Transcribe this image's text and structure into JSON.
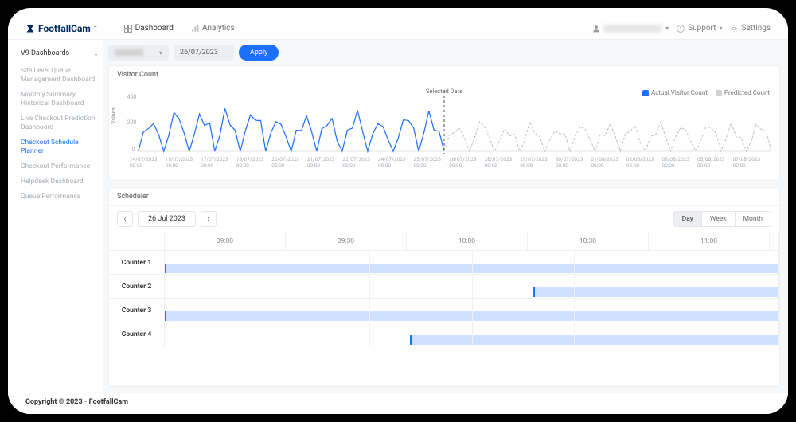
{
  "brand": {
    "name": "FootfallCam",
    "tm": "™"
  },
  "topnav": {
    "dashboard": "Dashboard",
    "analytics": "Analytics"
  },
  "topright": {
    "support": "Support",
    "settings": "Settings"
  },
  "sidebar": {
    "heading": "V9 Dashboards",
    "items": [
      "Site Level Queue Management Dashboard",
      "Monthly Summary Historical Dashboard",
      "Live Checkout Prediction Dashboard",
      "Checkout Schedule Planner",
      "Checkout Performance",
      "Helpdesk Dashboard",
      "Queue Performance"
    ],
    "active_index": 3
  },
  "filters": {
    "date": "26/07/2023",
    "apply": "Apply"
  },
  "chart": {
    "title": "Visitor Count",
    "selected_date_label": "Selected Date",
    "ylabel": "Values",
    "legend": {
      "actual": "Actual Visitor Count",
      "predicted": "Predicted Count"
    },
    "xticks": [
      "14/07/2023 00:00",
      "15/07/2023 00:00",
      "17/07/2023 00:00",
      "18/07/2023 00:00",
      "20/07/2023 00:00",
      "21/07/2023 00:00",
      "22/07/2023 00:00",
      "24/07/2023 00:00",
      "25/07/2023 00:00",
      "26/07/2023 00:00",
      "28/07/2023 00:00",
      "29/07/2023 00:00",
      "30/07/2023 00:00",
      "01/08/2023 00:00",
      "02/08/2023 00:00",
      "03/08/2023 00:00",
      "05/08/2023 00:00",
      "07/08/2023 00:00"
    ]
  },
  "scheduler": {
    "title": "Scheduler",
    "date": "26 Jul 2023",
    "views": {
      "day": "Day",
      "week": "Week",
      "month": "Month"
    },
    "time_headers": [
      "09:00",
      "09:30",
      "10:00",
      "10:30",
      "11:00"
    ],
    "counters": [
      "Counter 1",
      "Counter 2",
      "Counter 3",
      "Counter 4"
    ]
  },
  "footer": "Copyright © 2023 - FootfallCam",
  "chart_data": {
    "type": "line",
    "title": "Visitor Count",
    "ylabel": "Values",
    "ylim": [
      0,
      400
    ],
    "yticks": [
      0,
      200,
      400
    ],
    "selected_date": "26/07/2023 00:00",
    "x": [
      "14/07",
      "15/07",
      "16/07",
      "17/07",
      "18/07",
      "19/07",
      "20/07",
      "21/07",
      "22/07",
      "23/07",
      "24/07",
      "25/07",
      "26/07",
      "27/07",
      "28/07",
      "29/07",
      "30/07",
      "31/07",
      "01/08",
      "02/08",
      "03/08",
      "04/08",
      "05/08",
      "06/08",
      "07/08",
      "08/08"
    ],
    "series": [
      {
        "name": "Actual Visitor Count",
        "color": "#1d6fff",
        "segment": "historical",
        "_comment": "daily peak approximations read from chart (12 days 14/07–25/07)",
        "daily_peak": [
          240,
          260,
          300,
          260,
          320,
          220,
          260,
          230,
          280,
          210,
          260,
          260
        ]
      },
      {
        "name": "Predicted Count",
        "color": "#cfcfcf",
        "segment": "forecast",
        "_comment": "daily peak approximations (13 days 26/07–08/08)",
        "daily_peak": [
          200,
          200,
          180,
          180,
          180,
          180,
          200,
          180,
          200,
          180,
          200,
          180,
          200
        ]
      }
    ]
  },
  "scheduler_data": {
    "view": "Day",
    "time_range": [
      "09:00",
      "11:30"
    ],
    "rows": [
      {
        "label": "Counter 1",
        "bars": [
          {
            "start": "09:00",
            "end": "11:30"
          }
        ]
      },
      {
        "label": "Counter 2",
        "bars": [
          {
            "start": "10:30",
            "end": "11:30"
          }
        ]
      },
      {
        "label": "Counter 3",
        "bars": [
          {
            "start": "09:00",
            "end": "11:30"
          }
        ]
      },
      {
        "label": "Counter 4",
        "bars": [
          {
            "start": "10:00",
            "end": "11:30"
          }
        ]
      }
    ]
  }
}
